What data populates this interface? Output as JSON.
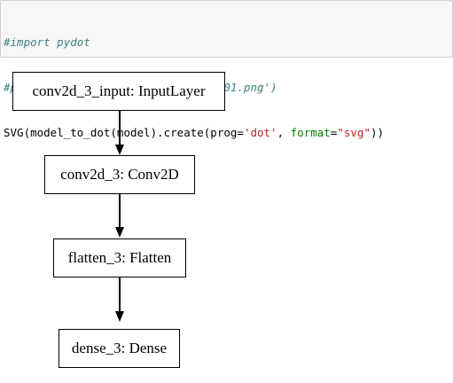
{
  "code": {
    "line1": "#import pydot",
    "line2": "#plot_model(model, to_file='model01.png')",
    "line3_parts": {
      "a": "SVG(model_to_dot(model).create(prog=",
      "b": "'dot'",
      "c": ", ",
      "d": "format",
      "e": "=",
      "f": "\"svg\"",
      "g": "))"
    }
  },
  "graph": {
    "nodes": [
      {
        "label": "conv2d_3_input: InputLayer"
      },
      {
        "label": "conv2d_3: Conv2D"
      },
      {
        "label": "flatten_3: Flatten"
      },
      {
        "label": "dense_3: Dense"
      }
    ]
  }
}
